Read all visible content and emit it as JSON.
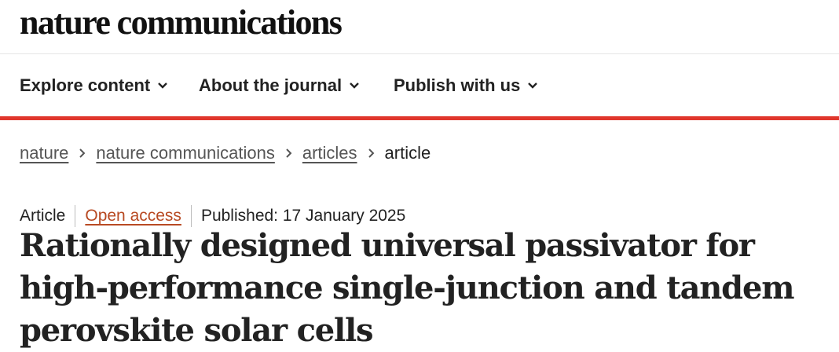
{
  "site": {
    "logo": "nature communications"
  },
  "nav": {
    "items": [
      {
        "label": "Explore content"
      },
      {
        "label": "About the journal"
      },
      {
        "label": "Publish with us"
      }
    ]
  },
  "breadcrumb": {
    "items": [
      "nature",
      "nature communications",
      "articles"
    ],
    "current": "article"
  },
  "article": {
    "type": "Article",
    "access": "Open access",
    "published": "Published: 17 January 2025",
    "title": "Rationally designed universal passivator for high-performance single-junction and tandem perovskite solar cells"
  },
  "colors": {
    "accent_red": "#e0362c",
    "open_access": "#b84a23"
  }
}
